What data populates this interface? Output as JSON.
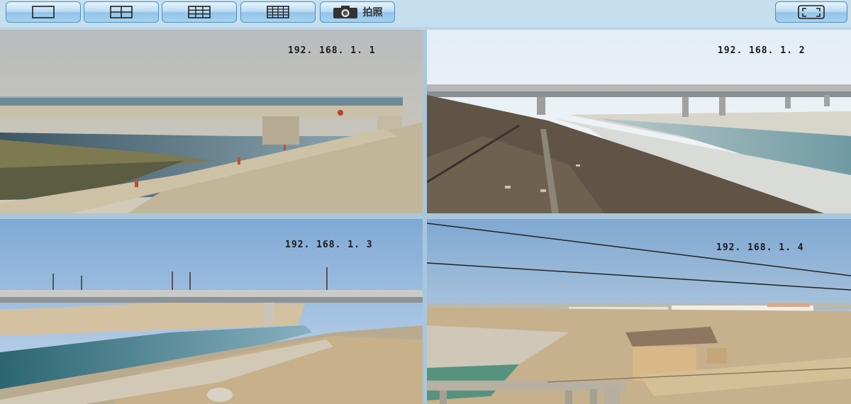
{
  "toolbar": {
    "layout_buttons": [
      {
        "name": "layout-1-button",
        "icon": "single-view-icon"
      },
      {
        "name": "layout-4-button",
        "icon": "quad-view-icon"
      },
      {
        "name": "layout-9-button",
        "icon": "nine-view-icon"
      },
      {
        "name": "layout-16-button",
        "icon": "sixteen-view-icon"
      }
    ],
    "snapshot_label": "拍照",
    "snapshot_icon": "camera-icon",
    "fullscreen_icon": "fullscreen-icon"
  },
  "cameras": [
    {
      "ip": "192. 168. 1. 1"
    },
    {
      "ip": "192. 168. 1. 2"
    },
    {
      "ip": "192. 168. 1. 3"
    },
    {
      "ip": "192. 168. 1. 4"
    }
  ],
  "colors": {
    "toolbar_bg": "#c6dfee",
    "button_border": "#4d90c6",
    "grid_border": "#a9c7dc"
  }
}
